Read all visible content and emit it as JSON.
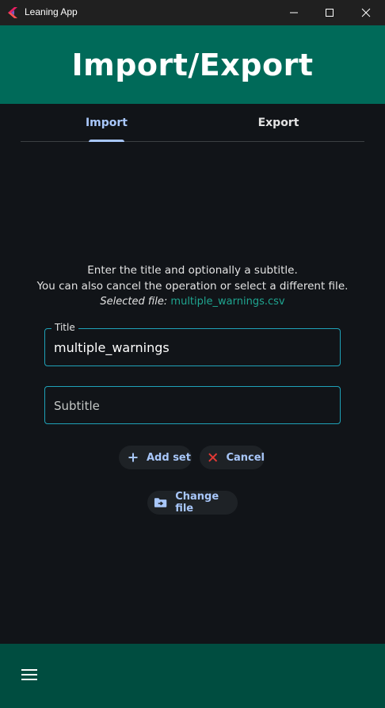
{
  "window": {
    "title": "Leaning App",
    "controls": [
      "minimize-icon",
      "maximize-icon",
      "close-icon"
    ]
  },
  "header": {
    "title": "Import/Export"
  },
  "tabs": [
    {
      "label": "Import",
      "active": true
    },
    {
      "label": "Export",
      "active": false
    }
  ],
  "instructions": {
    "line1": "Enter the title and optionally a subtitle.",
    "line2": "You can also cancel the operation or select a different file.",
    "selected_label": "Selected file:",
    "selected_file": "multiple_warnings.csv"
  },
  "form": {
    "title_label": "Title",
    "title_value": "multiple_warnings",
    "subtitle_placeholder": "Subtitle"
  },
  "actions": {
    "add_set": "Add set",
    "cancel": "Cancel",
    "change_file": "Change file"
  },
  "icons": {
    "add": "plus-icon",
    "cancel": "x-icon",
    "change_file": "folder-arrow-icon",
    "menu": "hamburger-menu-icon"
  },
  "colors": {
    "header_bg": "#006a59",
    "bottom_bar_bg": "#004d40",
    "accent": "#a8c7fa",
    "field_border": "#1fa2b8",
    "file_link": "#1fa590",
    "cancel_icon": "#e53935",
    "background": "#111418"
  }
}
